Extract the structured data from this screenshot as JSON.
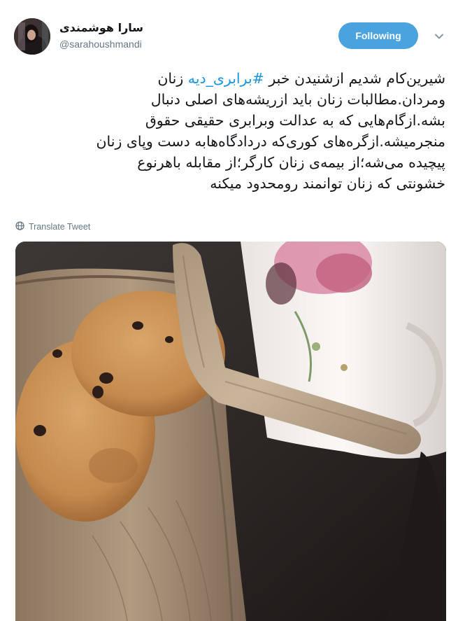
{
  "user": {
    "display_name": "سارا هوشمندی",
    "handle": "@sarahoushmandi"
  },
  "follow_button": {
    "label": "Following",
    "color": "#4aa3df"
  },
  "tweet": {
    "line1_before": "شیرین‌کام شدیم ازشنیدن خبر ",
    "hashtag": "#برابری_دیه",
    "line1_after": " زنان",
    "body": "ومردان.مطالبات زنان باید ازریشه‌های اصلی دنبال\nبشه.ازگام‌هایی که به عدالت وبرابری حقیقی حقوق\nمنجرمیشه.ازگره‌های کوری‌که دردادگاه‌هابه دست وپای زنان\nپیچیده می‌شه؛از بیمه‌ی زنان کارگر؛از مقابله باهرنوع\nخشونتی که زنان توانمند رومحدود میکنه"
  },
  "translate_label": "Translate Tweet",
  "icons": {
    "globe": "globe-icon",
    "caret": "chevron-down-icon"
  },
  "colors": {
    "text": "#14171a",
    "secondary": "#657786",
    "link": "#1b95e0"
  }
}
